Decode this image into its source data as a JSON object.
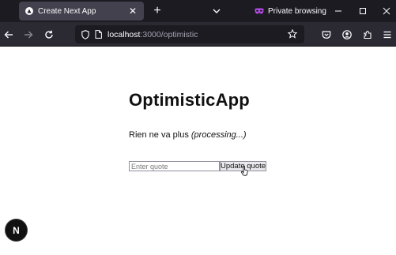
{
  "browser": {
    "tab": {
      "title": "Create Next App",
      "close_symbol": "✕",
      "favicon": "nextjs-triangle-icon"
    },
    "new_tab_symbol": "+",
    "private_label": "Private browsing",
    "url": {
      "host": "localhost",
      "path": ":3000/optimistic"
    },
    "icons": [
      "back-icon",
      "forward-icon",
      "reload-icon",
      "shield-icon",
      "page-icon",
      "star-icon",
      "pocket-icon",
      "account-icon",
      "extensions-icon",
      "menu-icon",
      "minimize-icon",
      "maximize-icon",
      "close-window-icon",
      "tab-list-icon",
      "private-mask-icon"
    ],
    "colors": {
      "titlebar": "#1c1b22",
      "toolbar": "#2b2a33",
      "active_tab": "#42414d",
      "private_accent": "#8000d7"
    }
  },
  "page": {
    "heading": "OptimisticApp",
    "status_text": "Rien ne va plus",
    "status_processing": "(processing...)",
    "input_placeholder": "Enter quote",
    "input_value": "",
    "button_label": "Update quote",
    "next_badge": "N"
  }
}
